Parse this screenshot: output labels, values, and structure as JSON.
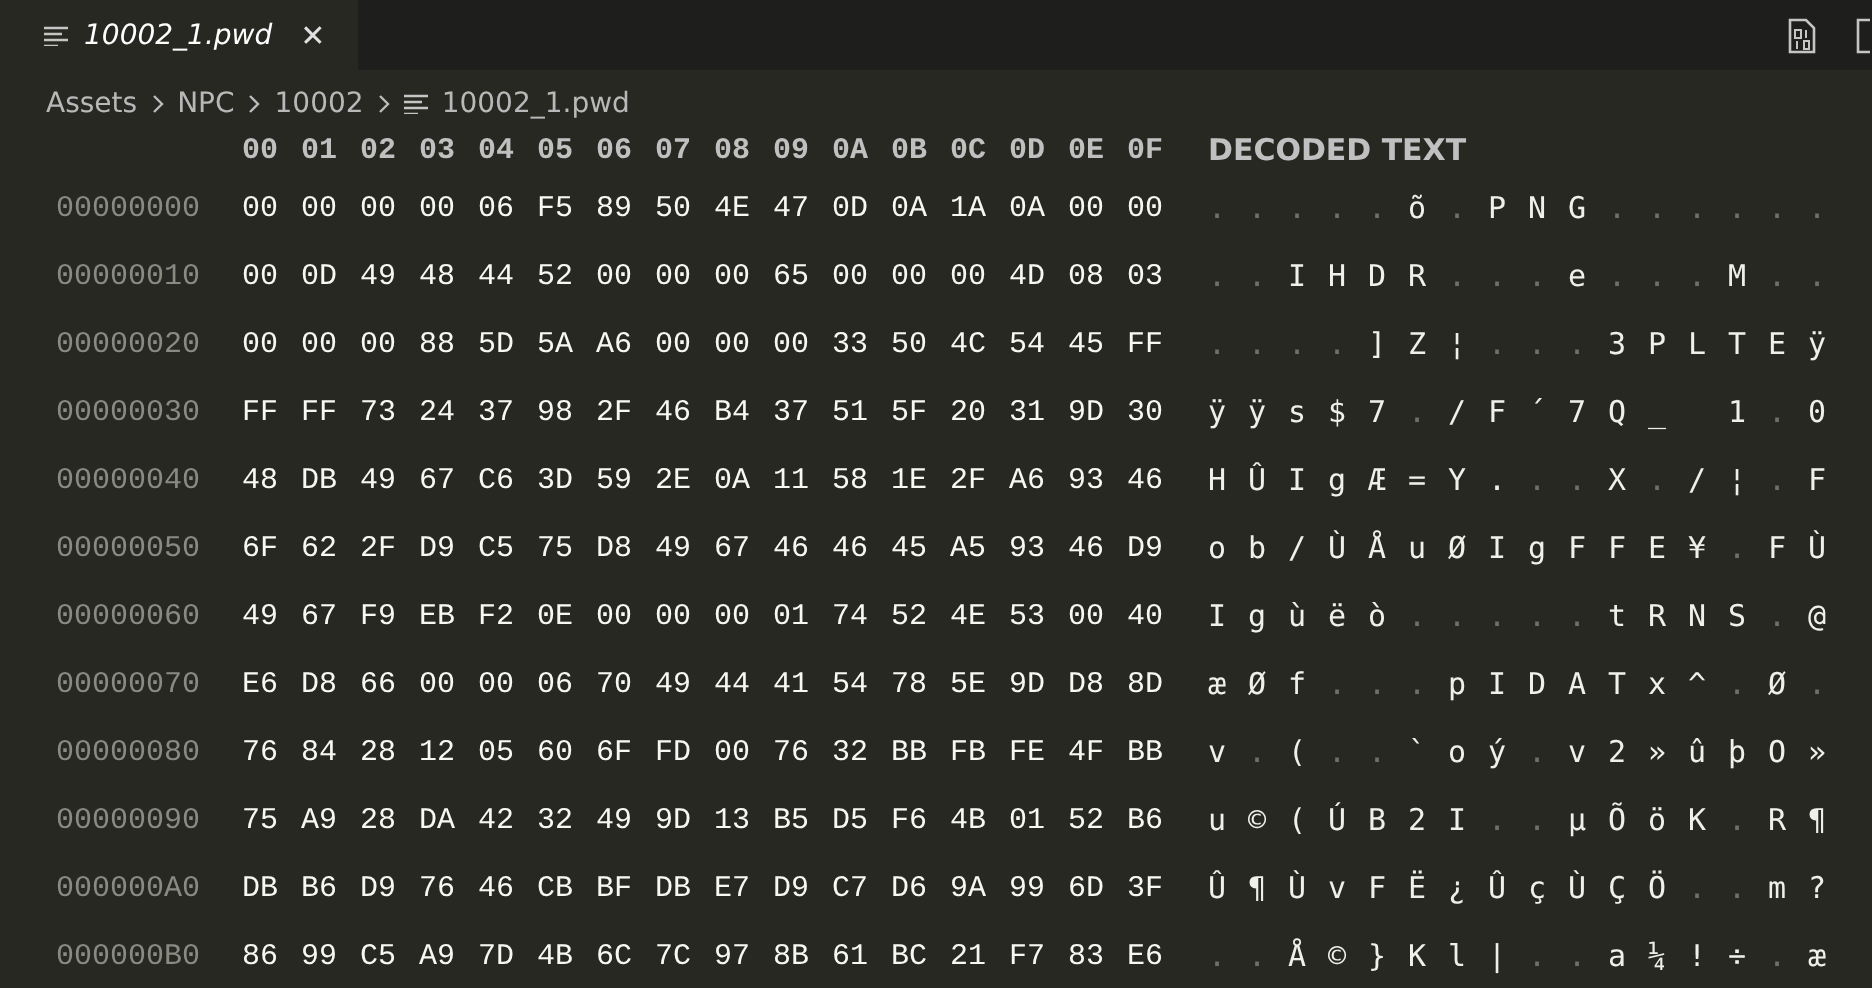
{
  "tab": {
    "title": "10002_1.pwd",
    "selected": true,
    "close": "✕"
  },
  "breadcrumb": [
    "Assets",
    "NPC",
    "10002",
    "10002_1.pwd"
  ],
  "header": {
    "offsets": [
      "00",
      "01",
      "02",
      "03",
      "04",
      "05",
      "06",
      "07",
      "08",
      "09",
      "0A",
      "0B",
      "0C",
      "0D",
      "0E",
      "0F"
    ],
    "decoded_title": "DECODED TEXT"
  },
  "rows": [
    {
      "address": "00000000",
      "bytes": [
        "00",
        "00",
        "00",
        "00",
        "06",
        "F5",
        "89",
        "50",
        "4E",
        "47",
        "0D",
        "0A",
        "1A",
        "0A",
        "00",
        "00"
      ],
      "decoded": [
        {
          "t": ".",
          "dim": true
        },
        {
          "t": ".",
          "dim": true
        },
        {
          "t": ".",
          "dim": true
        },
        {
          "t": ".",
          "dim": true
        },
        {
          "t": ".",
          "dim": true
        },
        {
          "t": "õ",
          "dim": false
        },
        {
          "t": ".",
          "dim": true
        },
        {
          "t": "P",
          "dim": false
        },
        {
          "t": "N",
          "dim": false
        },
        {
          "t": "G",
          "dim": false
        },
        {
          "t": ".",
          "dim": true
        },
        {
          "t": ".",
          "dim": true
        },
        {
          "t": ".",
          "dim": true
        },
        {
          "t": ".",
          "dim": true
        },
        {
          "t": ".",
          "dim": true
        },
        {
          "t": ".",
          "dim": true
        }
      ]
    },
    {
      "address": "00000010",
      "bytes": [
        "00",
        "0D",
        "49",
        "48",
        "44",
        "52",
        "00",
        "00",
        "00",
        "65",
        "00",
        "00",
        "00",
        "4D",
        "08",
        "03"
      ],
      "decoded": [
        {
          "t": ".",
          "dim": true
        },
        {
          "t": ".",
          "dim": true
        },
        {
          "t": "I",
          "dim": false
        },
        {
          "t": "H",
          "dim": false
        },
        {
          "t": "D",
          "dim": false
        },
        {
          "t": "R",
          "dim": false
        },
        {
          "t": ".",
          "dim": true
        },
        {
          "t": ".",
          "dim": true
        },
        {
          "t": ".",
          "dim": true
        },
        {
          "t": "e",
          "dim": false
        },
        {
          "t": ".",
          "dim": true
        },
        {
          "t": ".",
          "dim": true
        },
        {
          "t": ".",
          "dim": true
        },
        {
          "t": "M",
          "dim": false
        },
        {
          "t": ".",
          "dim": true
        },
        {
          "t": ".",
          "dim": true
        }
      ]
    },
    {
      "address": "00000020",
      "bytes": [
        "00",
        "00",
        "00",
        "88",
        "5D",
        "5A",
        "A6",
        "00",
        "00",
        "00",
        "33",
        "50",
        "4C",
        "54",
        "45",
        "FF"
      ],
      "decoded": [
        {
          "t": ".",
          "dim": true
        },
        {
          "t": ".",
          "dim": true
        },
        {
          "t": ".",
          "dim": true
        },
        {
          "t": ".",
          "dim": true
        },
        {
          "t": "]",
          "dim": false
        },
        {
          "t": "Z",
          "dim": false
        },
        {
          "t": "¦",
          "dim": false
        },
        {
          "t": ".",
          "dim": true
        },
        {
          "t": ".",
          "dim": true
        },
        {
          "t": ".",
          "dim": true
        },
        {
          "t": "3",
          "dim": false
        },
        {
          "t": "P",
          "dim": false
        },
        {
          "t": "L",
          "dim": false
        },
        {
          "t": "T",
          "dim": false
        },
        {
          "t": "E",
          "dim": false
        },
        {
          "t": "ÿ",
          "dim": false
        }
      ]
    },
    {
      "address": "00000030",
      "bytes": [
        "FF",
        "FF",
        "73",
        "24",
        "37",
        "98",
        "2F",
        "46",
        "B4",
        "37",
        "51",
        "5F",
        "20",
        "31",
        "9D",
        "30"
      ],
      "decoded": [
        {
          "t": "ÿ",
          "dim": false
        },
        {
          "t": "ÿ",
          "dim": false
        },
        {
          "t": "s",
          "dim": false
        },
        {
          "t": "$",
          "dim": false
        },
        {
          "t": "7",
          "dim": false
        },
        {
          "t": ".",
          "dim": true
        },
        {
          "t": "/",
          "dim": false
        },
        {
          "t": "F",
          "dim": false
        },
        {
          "t": "´",
          "dim": false
        },
        {
          "t": "7",
          "dim": false
        },
        {
          "t": "Q",
          "dim": false
        },
        {
          "t": "_",
          "dim": false
        },
        {
          "kind": "space"
        },
        {
          "t": "1",
          "dim": false
        },
        {
          "t": ".",
          "dim": true
        },
        {
          "t": "0",
          "dim": false
        }
      ]
    },
    {
      "address": "00000040",
      "bytes": [
        "48",
        "DB",
        "49",
        "67",
        "C6",
        "3D",
        "59",
        "2E",
        "0A",
        "11",
        "58",
        "1E",
        "2F",
        "A6",
        "93",
        "46"
      ],
      "decoded": [
        {
          "t": "H",
          "dim": false
        },
        {
          "t": "Û",
          "dim": false
        },
        {
          "t": "I",
          "dim": false
        },
        {
          "t": "g",
          "dim": false
        },
        {
          "t": "Æ",
          "dim": false
        },
        {
          "t": "=",
          "dim": false
        },
        {
          "t": "Y",
          "dim": false
        },
        {
          "t": ".",
          "dim": false
        },
        {
          "t": ".",
          "dim": true
        },
        {
          "t": ".",
          "dim": true
        },
        {
          "t": "X",
          "dim": false
        },
        {
          "t": ".",
          "dim": true
        },
        {
          "t": "/",
          "dim": false
        },
        {
          "t": "¦",
          "dim": false
        },
        {
          "t": ".",
          "dim": true
        },
        {
          "t": "F",
          "dim": false
        }
      ]
    },
    {
      "address": "00000050",
      "bytes": [
        "6F",
        "62",
        "2F",
        "D9",
        "C5",
        "75",
        "D8",
        "49",
        "67",
        "46",
        "46",
        "45",
        "A5",
        "93",
        "46",
        "D9"
      ],
      "decoded": [
        {
          "t": "o",
          "dim": false
        },
        {
          "t": "b",
          "dim": false
        },
        {
          "t": "/",
          "dim": false
        },
        {
          "t": "Ù",
          "dim": false
        },
        {
          "t": "Å",
          "dim": false
        },
        {
          "t": "u",
          "dim": false
        },
        {
          "t": "Ø",
          "dim": false
        },
        {
          "t": "I",
          "dim": false
        },
        {
          "t": "g",
          "dim": false
        },
        {
          "t": "F",
          "dim": false
        },
        {
          "t": "F",
          "dim": false
        },
        {
          "t": "E",
          "dim": false
        },
        {
          "t": "¥",
          "dim": false
        },
        {
          "t": ".",
          "dim": true
        },
        {
          "t": "F",
          "dim": false
        },
        {
          "t": "Ù",
          "dim": false
        }
      ]
    },
    {
      "address": "00000060",
      "bytes": [
        "49",
        "67",
        "F9",
        "EB",
        "F2",
        "0E",
        "00",
        "00",
        "00",
        "01",
        "74",
        "52",
        "4E",
        "53",
        "00",
        "40"
      ],
      "decoded": [
        {
          "t": "I",
          "dim": false
        },
        {
          "t": "g",
          "dim": false
        },
        {
          "t": "ù",
          "dim": false
        },
        {
          "t": "ë",
          "dim": false
        },
        {
          "t": "ò",
          "dim": false
        },
        {
          "t": ".",
          "dim": true
        },
        {
          "t": ".",
          "dim": true
        },
        {
          "t": ".",
          "dim": true
        },
        {
          "t": ".",
          "dim": true
        },
        {
          "t": ".",
          "dim": true
        },
        {
          "t": "t",
          "dim": false
        },
        {
          "t": "R",
          "dim": false
        },
        {
          "t": "N",
          "dim": false
        },
        {
          "t": "S",
          "dim": false
        },
        {
          "t": ".",
          "dim": true
        },
        {
          "t": "@",
          "dim": false
        }
      ]
    },
    {
      "address": "00000070",
      "bytes": [
        "E6",
        "D8",
        "66",
        "00",
        "00",
        "06",
        "70",
        "49",
        "44",
        "41",
        "54",
        "78",
        "5E",
        "9D",
        "D8",
        "8D"
      ],
      "decoded": [
        {
          "t": "æ",
          "dim": false
        },
        {
          "t": "Ø",
          "dim": false
        },
        {
          "t": "f",
          "dim": false
        },
        {
          "t": ".",
          "dim": true
        },
        {
          "t": ".",
          "dim": true
        },
        {
          "t": ".",
          "dim": true
        },
        {
          "t": "p",
          "dim": false
        },
        {
          "t": "I",
          "dim": false
        },
        {
          "t": "D",
          "dim": false
        },
        {
          "t": "A",
          "dim": false
        },
        {
          "t": "T",
          "dim": false
        },
        {
          "t": "x",
          "dim": false
        },
        {
          "t": "^",
          "dim": false
        },
        {
          "t": ".",
          "dim": true
        },
        {
          "t": "Ø",
          "dim": false
        },
        {
          "t": ".",
          "dim": true
        }
      ]
    },
    {
      "address": "00000080",
      "bytes": [
        "76",
        "84",
        "28",
        "12",
        "05",
        "60",
        "6F",
        "FD",
        "00",
        "76",
        "32",
        "BB",
        "FB",
        "FE",
        "4F",
        "BB"
      ],
      "decoded": [
        {
          "t": "v",
          "dim": false
        },
        {
          "t": ".",
          "dim": true
        },
        {
          "t": "(",
          "dim": false
        },
        {
          "t": ".",
          "dim": true
        },
        {
          "t": ".",
          "dim": true
        },
        {
          "t": "`",
          "dim": false
        },
        {
          "t": "o",
          "dim": false
        },
        {
          "t": "ý",
          "dim": false
        },
        {
          "t": ".",
          "dim": true
        },
        {
          "t": "v",
          "dim": false
        },
        {
          "t": "2",
          "dim": false
        },
        {
          "t": "»",
          "dim": false
        },
        {
          "t": "û",
          "dim": false
        },
        {
          "t": "þ",
          "dim": false
        },
        {
          "t": "O",
          "dim": false
        },
        {
          "t": "»",
          "dim": false
        }
      ]
    },
    {
      "address": "00000090",
      "bytes": [
        "75",
        "A9",
        "28",
        "DA",
        "42",
        "32",
        "49",
        "9D",
        "13",
        "B5",
        "D5",
        "F6",
        "4B",
        "01",
        "52",
        "B6"
      ],
      "decoded": [
        {
          "t": "u",
          "dim": false
        },
        {
          "t": "©",
          "dim": false
        },
        {
          "t": "(",
          "dim": false
        },
        {
          "t": "Ú",
          "dim": false
        },
        {
          "t": "B",
          "dim": false
        },
        {
          "t": "2",
          "dim": false
        },
        {
          "t": "I",
          "dim": false
        },
        {
          "t": ".",
          "dim": true
        },
        {
          "t": ".",
          "dim": true
        },
        {
          "t": "µ",
          "dim": false
        },
        {
          "t": "Õ",
          "dim": false
        },
        {
          "t": "ö",
          "dim": false
        },
        {
          "t": "K",
          "dim": false
        },
        {
          "t": ".",
          "dim": true
        },
        {
          "t": "R",
          "dim": false
        },
        {
          "t": "¶",
          "dim": false
        }
      ]
    },
    {
      "address": "000000A0",
      "bytes": [
        "DB",
        "B6",
        "D9",
        "76",
        "46",
        "CB",
        "BF",
        "DB",
        "E7",
        "D9",
        "C7",
        "D6",
        "9A",
        "99",
        "6D",
        "3F"
      ],
      "decoded": [
        {
          "t": "Û",
          "dim": false
        },
        {
          "t": "¶",
          "dim": false
        },
        {
          "t": "Ù",
          "dim": false
        },
        {
          "t": "v",
          "dim": false
        },
        {
          "t": "F",
          "dim": false
        },
        {
          "t": "Ë",
          "dim": false
        },
        {
          "t": "¿",
          "dim": false
        },
        {
          "t": "Û",
          "dim": false
        },
        {
          "t": "ç",
          "dim": false
        },
        {
          "t": "Ù",
          "dim": false
        },
        {
          "t": "Ç",
          "dim": false
        },
        {
          "t": "Ö",
          "dim": false
        },
        {
          "t": ".",
          "dim": true
        },
        {
          "t": ".",
          "dim": true
        },
        {
          "t": "m",
          "dim": false
        },
        {
          "t": "?",
          "dim": false
        }
      ]
    },
    {
      "address": "000000B0",
      "bytes": [
        "86",
        "99",
        "C5",
        "A9",
        "7D",
        "4B",
        "6C",
        "7C",
        "97",
        "8B",
        "61",
        "BC",
        "21",
        "F7",
        "83",
        "E6"
      ],
      "decoded": [
        {
          "t": ".",
          "dim": true
        },
        {
          "t": ".",
          "dim": true
        },
        {
          "t": "Å",
          "dim": false
        },
        {
          "t": "©",
          "dim": false
        },
        {
          "t": "}",
          "dim": false
        },
        {
          "t": "K",
          "dim": false
        },
        {
          "t": "l",
          "dim": false
        },
        {
          "t": "|",
          "dim": false
        },
        {
          "t": ".",
          "dim": true
        },
        {
          "t": ".",
          "dim": true
        },
        {
          "t": "a",
          "dim": false
        },
        {
          "t": "¼",
          "dim": false
        },
        {
          "t": "!",
          "dim": false
        },
        {
          "t": "÷",
          "dim": false
        },
        {
          "t": ".",
          "dim": true
        },
        {
          "t": "æ",
          "dim": false
        }
      ]
    }
  ]
}
